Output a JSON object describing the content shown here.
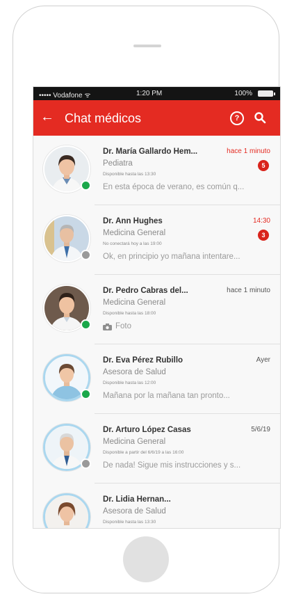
{
  "status_bar": {
    "carrier": "•••••  Vodafone  ᯤ",
    "time": "1:20 PM",
    "battery": "100%"
  },
  "app_bar": {
    "title": "Chat médicos",
    "back_icon": "arrow-left-icon",
    "help_icon": "question-circle-icon",
    "search_icon": "search-icon"
  },
  "colors": {
    "brand": "#e42b22",
    "online": "#1aa84a",
    "offline": "#9a9a9a",
    "badge": "#d9241c"
  },
  "chats": [
    {
      "name": "Dr. María Gallardo Hem...",
      "time": "hace 1 minuto",
      "specialty": "Pediatra",
      "availability": "Disponible hasta las 13:30",
      "preview": "En esta época de verano, es común q...",
      "unread": "5",
      "status": "online"
    },
    {
      "name": "Dr. Ann Hughes",
      "time": "14:30",
      "specialty": "Medicina General",
      "availability": "No conectará hoy a las 19:00",
      "preview": "Ok, en principio yo mañana intentare...",
      "unread": "3",
      "status": "offline"
    },
    {
      "name": "Dr. Pedro Cabras del...",
      "time": "hace 1 minuto",
      "specialty": "Medicina General",
      "availability": "Disponible hasta las 18:00",
      "preview": "Foto",
      "preview_icon": "camera-icon",
      "status": "online"
    },
    {
      "name": "Dr. Eva Pérez Rubillo",
      "time": "Ayer",
      "specialty": "Asesora de Salud",
      "availability": "Disponible hasta las 12:00",
      "preview": "Mañana por la mañana tan pronto...",
      "status": "online"
    },
    {
      "name": "Dr. Arturo López Casas",
      "time": "5/6/19",
      "specialty": "Medicina General",
      "availability": "Disponible a partir del 6/6/19 a las 16:00",
      "preview": "De nada! Sigue mis instrucciones y s...",
      "status": "offline"
    },
    {
      "name": "Dr. Lidia Hernan...",
      "time": "",
      "specialty": "Asesora de Salud",
      "availability": "Disponible hasta las 13:30",
      "preview": "",
      "status": "none"
    }
  ]
}
